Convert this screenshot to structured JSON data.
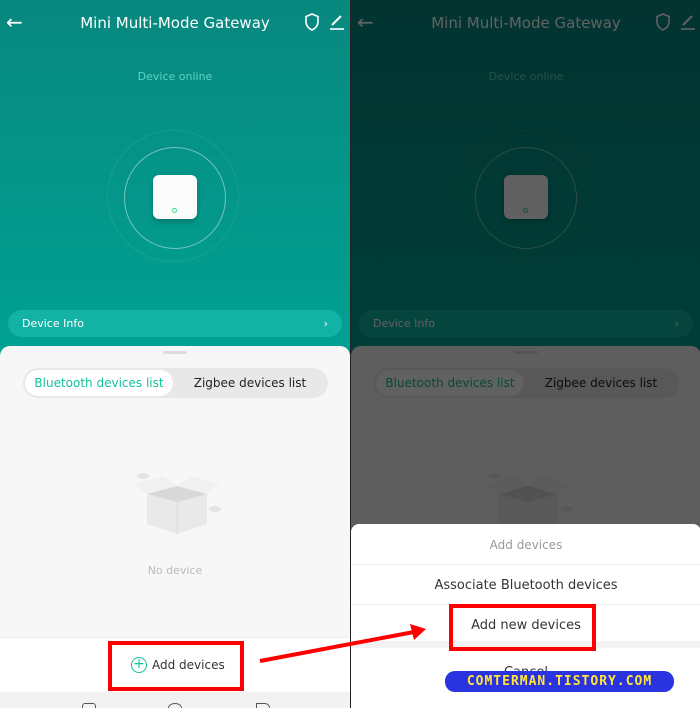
{
  "header": {
    "title": "Mini Multi-Mode Gateway",
    "status": "Device online",
    "icons": [
      "back-arrow-icon",
      "shield-icon",
      "edit-icon"
    ]
  },
  "device_info": {
    "label": "Device Info"
  },
  "tabs": [
    {
      "label": "Bluetooth devices list",
      "active": true
    },
    {
      "label": "Zigbee devices list",
      "active": false
    }
  ],
  "empty": {
    "text": "No device"
  },
  "bottom": {
    "add_label": "Add devices"
  },
  "action_sheet": {
    "title": "Add devices",
    "items": [
      "Associate Bluetooth devices",
      "Add new devices"
    ],
    "cancel": "Cancel"
  },
  "watermark": "COMTERMAN.TISTORY.COM",
  "colors": {
    "accent": "#12c29a",
    "header": "#00a293",
    "highlight": "#ff0000"
  }
}
